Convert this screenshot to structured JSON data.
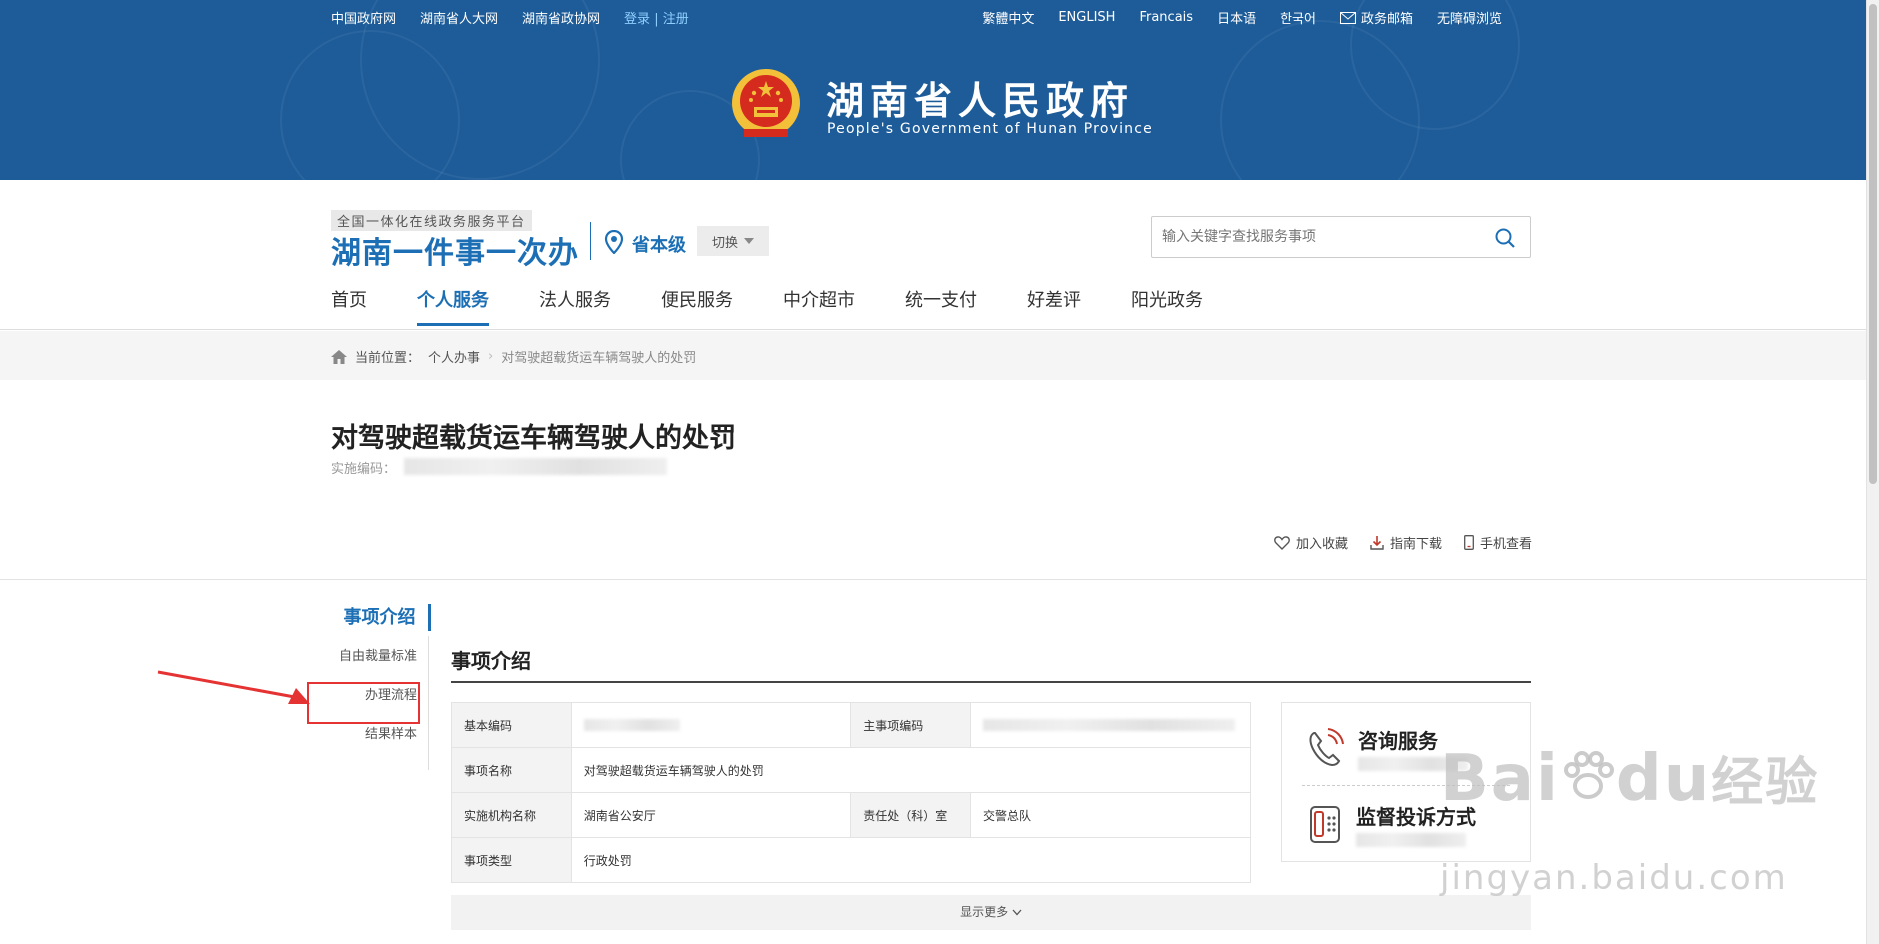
{
  "top_links": {
    "left": [
      "中国政府网",
      "湖南省人大网",
      "湖南省政协网"
    ],
    "login": "登录",
    "sep": "|",
    "register": "注册",
    "right": [
      "繁體中文",
      "ENGLISH",
      "Francais",
      "日本语",
      "한국어"
    ],
    "mail": "政务邮箱",
    "accessible": "无障碍浏览"
  },
  "banner": {
    "title": "湖南省人民政府",
    "subtitle": "People's Government of Hunan Province"
  },
  "platform": {
    "tag": "全国一体化在线政务服务平台",
    "name": "湖南一件事一次办",
    "level": "省本级",
    "switch": "切换"
  },
  "search": {
    "placeholder": "输入关键字查找服务事项"
  },
  "nav": [
    "首页",
    "个人服务",
    "法人服务",
    "便民服务",
    "中介超市",
    "统一支付",
    "好差评",
    "阳光政务"
  ],
  "breadcrumb": {
    "label": "当前位置：",
    "level1": "个人办事",
    "sep": "›",
    "current": "对驾驶超载货运车辆驾驶人的处罚"
  },
  "item": {
    "title": "对驾驶超载货运车辆驾驶人的处罚",
    "code_label": "实施编码："
  },
  "actions": {
    "favorite": "加入收藏",
    "download": "指南下载",
    "mobile": "手机查看"
  },
  "side_menu": [
    "事项介绍",
    "自由裁量标准",
    "办理流程",
    "结果样本"
  ],
  "content": {
    "heading": "事项介绍",
    "rows": [
      {
        "l1": "基本编码",
        "v1": "",
        "l2": "主事项编码",
        "v2": ""
      },
      {
        "l1": "事项名称",
        "v1": "对驾驶超载货运车辆驾驶人的处罚"
      },
      {
        "l1": "实施机构名称",
        "v1": "湖南省公安厅",
        "l2": "责任处（科）室",
        "v2": "交警总队"
      },
      {
        "l1": "事项类型",
        "v1": "行政处罚"
      }
    ],
    "more": "显示更多"
  },
  "panel": {
    "consult": "咨询服务",
    "supervise": "监督投诉方式"
  },
  "watermark": {
    "brand": "Bai",
    "brand2": "du",
    "cn": "经验",
    "url": "jingyan.baidu.com"
  },
  "colors": {
    "header": "#1d5c99",
    "accent": "#1c6fb5",
    "highlight": "#e53333"
  }
}
